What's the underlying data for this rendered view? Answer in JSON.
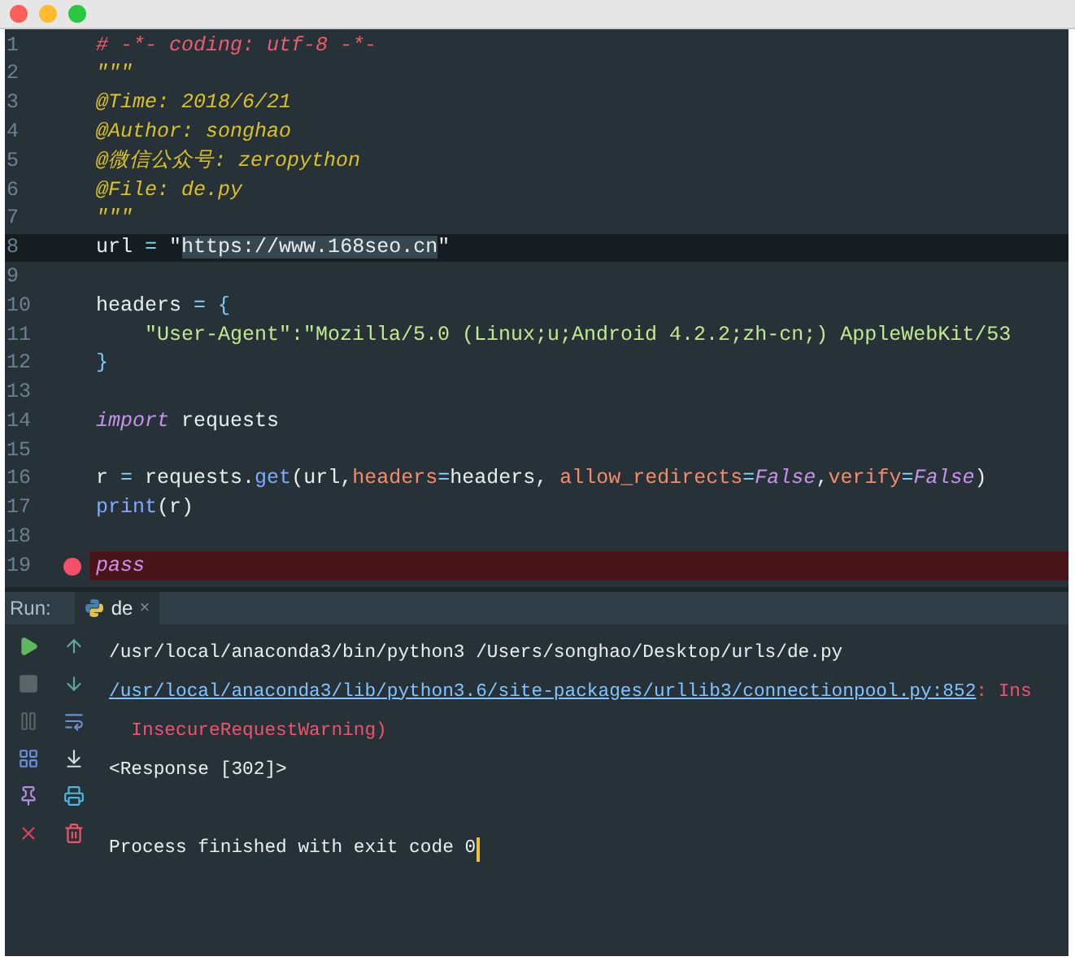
{
  "editor": {
    "lines": [
      {
        "number": "1",
        "current": false,
        "breakpoint": false,
        "tokens": [
          {
            "text": "# -*- coding: utf-8 -*-",
            "kind": "comment"
          }
        ]
      },
      {
        "number": "2",
        "current": false,
        "breakpoint": false,
        "tokens": [
          {
            "text": "\"\"\"",
            "kind": "doc"
          }
        ]
      },
      {
        "number": "3",
        "current": false,
        "breakpoint": false,
        "tokens": [
          {
            "text": "@Time: 2018/6/21",
            "kind": "doc"
          }
        ]
      },
      {
        "number": "4",
        "current": false,
        "breakpoint": false,
        "tokens": [
          {
            "text": "@Author: songhao",
            "kind": "doc"
          }
        ]
      },
      {
        "number": "5",
        "current": false,
        "breakpoint": false,
        "tokens": [
          {
            "text": "@微信公众号: zeropython",
            "kind": "doc"
          }
        ]
      },
      {
        "number": "6",
        "current": false,
        "breakpoint": false,
        "tokens": [
          {
            "text": "@File: de.py",
            "kind": "doc"
          }
        ]
      },
      {
        "number": "7",
        "current": false,
        "breakpoint": false,
        "tokens": [
          {
            "text": "\"\"\"",
            "kind": "doc"
          }
        ]
      },
      {
        "number": "8",
        "current": true,
        "breakpoint": false,
        "tokens": [
          {
            "text": "url ",
            "kind": "plain"
          },
          {
            "text": "=",
            "kind": "operator"
          },
          {
            "text": " \"",
            "kind": "plain"
          },
          {
            "text": "https://www.168seo.cn",
            "kind": "highlight"
          },
          {
            "text": "\"",
            "kind": "plain"
          }
        ]
      },
      {
        "number": "9",
        "current": false,
        "breakpoint": false
      },
      {
        "number": "10",
        "current": false,
        "breakpoint": false,
        "tokens": [
          {
            "text": "headers ",
            "kind": "plain"
          },
          {
            "text": "=",
            "kind": "operator"
          },
          {
            "text": " {",
            "kind": "punct"
          }
        ]
      },
      {
        "number": "11",
        "current": false,
        "breakpoint": false,
        "tokens": [
          {
            "text": "    \"User-Agent\":\"Mozilla/5.0 (Linux;u;Android 4.2.2;zh-cn;) AppleWebKit/53",
            "kind": "string"
          }
        ]
      },
      {
        "number": "12",
        "current": false,
        "breakpoint": false,
        "tokens": [
          {
            "text": "}",
            "kind": "punct"
          }
        ]
      },
      {
        "number": "13",
        "current": false,
        "breakpoint": false
      },
      {
        "number": "14",
        "current": false,
        "breakpoint": false,
        "tokens": [
          {
            "text": "import",
            "kind": "keyword"
          },
          {
            "text": " requests",
            "kind": "plain"
          }
        ]
      },
      {
        "number": "15",
        "current": false,
        "breakpoint": false
      },
      {
        "number": "16",
        "current": false,
        "breakpoint": false,
        "tokens": [
          {
            "text": "r ",
            "kind": "plain"
          },
          {
            "text": "=",
            "kind": "operator"
          },
          {
            "text": " requests.",
            "kind": "plain"
          },
          {
            "text": "get",
            "kind": "func"
          },
          {
            "text": "(url,",
            "kind": "plain"
          },
          {
            "text": "headers",
            "kind": "param"
          },
          {
            "text": "=",
            "kind": "operator"
          },
          {
            "text": "headers, ",
            "kind": "plain"
          },
          {
            "text": "allow_redirects",
            "kind": "param"
          },
          {
            "text": "=",
            "kind": "operator"
          },
          {
            "text": "False",
            "kind": "keyword"
          },
          {
            "text": ",",
            "kind": "plain"
          },
          {
            "text": "verify",
            "kind": "param"
          },
          {
            "text": "=",
            "kind": "operator"
          },
          {
            "text": "False",
            "kind": "keyword"
          },
          {
            "text": ")",
            "kind": "plain"
          }
        ]
      },
      {
        "number": "17",
        "current": false,
        "breakpoint": false,
        "tokens": [
          {
            "text": "print",
            "kind": "func"
          },
          {
            "text": "(r)",
            "kind": "plain"
          }
        ]
      },
      {
        "number": "18",
        "current": false,
        "breakpoint": false
      },
      {
        "number": "19",
        "current": false,
        "breakpoint": true,
        "tokens": [
          {
            "text": "pass",
            "kind": "keyword"
          }
        ]
      }
    ]
  },
  "run_panel": {
    "label": "Run:",
    "tabs": [
      {
        "label": "de",
        "close": "×",
        "selected": true
      }
    ],
    "console": [
      {
        "cursor": false,
        "tokens": [
          {
            "text": "/usr/local/anaconda3/bin/python3 /Users/songhao/Desktop/urls/de.py",
            "kind": "plain"
          }
        ]
      },
      {
        "cursor": false,
        "tokens": [
          {
            "text": "/usr/local/anaconda3/lib/python3.6/site-packages/urllib3/connectionpool.py:852",
            "kind": "link"
          },
          {
            "text": ": Ins",
            "kind": "error"
          }
        ]
      },
      {
        "cursor": false,
        "tokens": [
          {
            "text": "  InsecureRequestWarning)",
            "kind": "error"
          }
        ]
      },
      {
        "cursor": false,
        "tokens": [
          {
            "text": "<Response [302]>",
            "kind": "plain"
          }
        ]
      },
      {
        "cursor": false
      },
      {
        "cursor": true,
        "tokens": [
          {
            "text": "Process finished with exit code 0",
            "kind": "plain"
          }
        ]
      }
    ]
  }
}
